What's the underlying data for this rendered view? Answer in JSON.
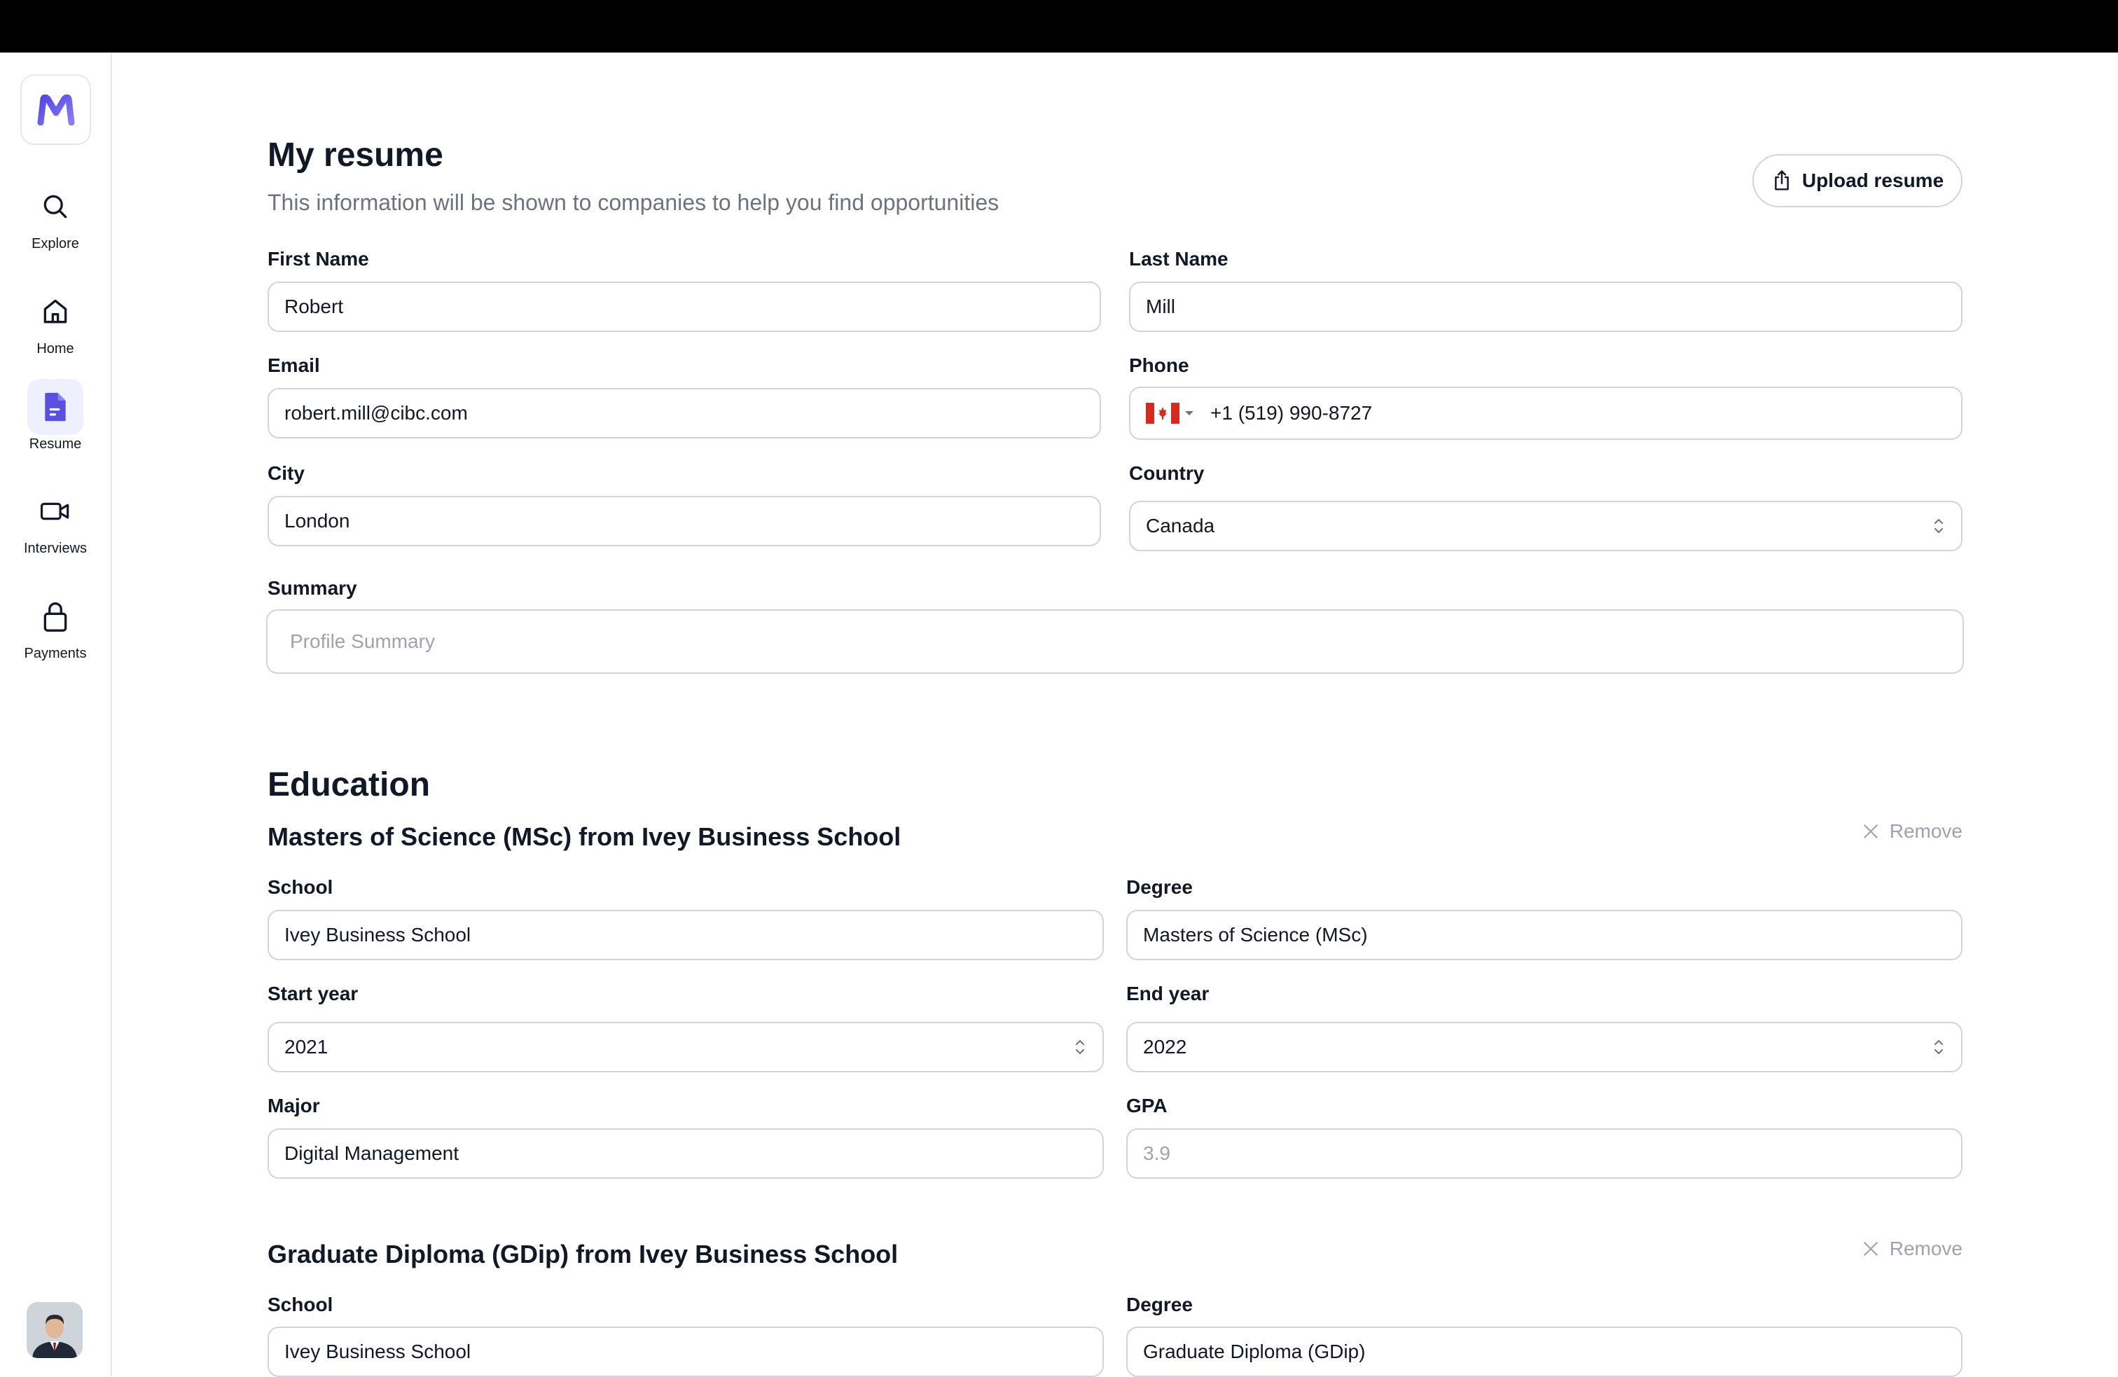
{
  "sidebar": {
    "items": [
      {
        "label": "Explore"
      },
      {
        "label": "Home"
      },
      {
        "label": "Resume"
      },
      {
        "label": "Interviews"
      },
      {
        "label": "Payments"
      }
    ]
  },
  "header": {
    "title": "My resume",
    "subtitle": "This information will be shown to companies to help you find opportunities",
    "upload_label": "Upload resume"
  },
  "personal": {
    "first_name_label": "First Name",
    "first_name": "Robert",
    "last_name_label": "Last Name",
    "last_name": "Mill",
    "email_label": "Email",
    "email": "robert.mill@cibc.com",
    "phone_label": "Phone",
    "phone": "+1 (519) 990-8727",
    "city_label": "City",
    "city": "London",
    "country_label": "Country",
    "country": "Canada",
    "summary_label": "Summary",
    "summary_placeholder": "Profile Summary"
  },
  "education": {
    "title": "Education",
    "remove_label": "Remove",
    "entries": [
      {
        "title": "Masters of Science (MSc) from Ivey Business School",
        "school_label": "School",
        "school": "Ivey Business School",
        "degree_label": "Degree",
        "degree": "Masters of Science (MSc)",
        "start_label": "Start year",
        "start": "2021",
        "end_label": "End year",
        "end": "2022",
        "major_label": "Major",
        "major": "Digital Management",
        "gpa_label": "GPA",
        "gpa": "3.9"
      },
      {
        "title": "Graduate Diploma (GDip) from Ivey Business School",
        "school_label": "School",
        "school": "Ivey Business School",
        "degree_label": "Degree",
        "degree": "Graduate Diploma (GDip)"
      }
    ]
  },
  "colors": {
    "accent": "#5b4fe0",
    "border": "#d1d5db",
    "muted": "#6b7280"
  }
}
